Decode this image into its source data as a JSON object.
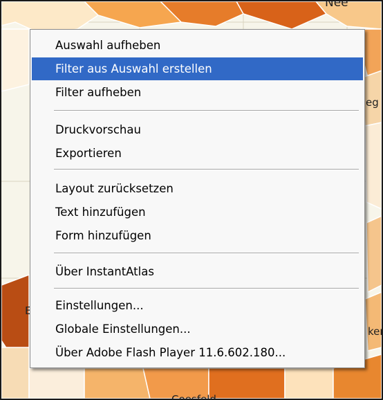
{
  "map": {
    "labels": {
      "top_right": "Nee",
      "right_eg": "eg",
      "left_e": "E",
      "right_ken": "ken",
      "bottom_c": "Coesfeld"
    },
    "colors": {
      "background": "#f7f5ea",
      "light": "#fde0b3",
      "medium": "#f6a64f",
      "strong": "#e57220",
      "dark": "#b94d14"
    }
  },
  "context_menu": {
    "groups": [
      {
        "items": [
          {
            "label": "Auswahl aufheben",
            "highlighted": false
          },
          {
            "label": "Filter aus Auswahl erstellen",
            "highlighted": true
          },
          {
            "label": "Filter aufheben",
            "highlighted": false
          }
        ]
      },
      {
        "items": [
          {
            "label": "Druckvorschau",
            "highlighted": false
          },
          {
            "label": "Exportieren",
            "highlighted": false
          }
        ]
      },
      {
        "items": [
          {
            "label": "Layout zurücksetzen",
            "highlighted": false
          },
          {
            "label": "Text hinzufügen",
            "highlighted": false
          },
          {
            "label": "Form hinzufügen",
            "highlighted": false
          }
        ]
      },
      {
        "items": [
          {
            "label": "Über InstantAtlas",
            "highlighted": false
          }
        ]
      },
      {
        "items": [
          {
            "label": "Einstellungen...",
            "highlighted": false
          },
          {
            "label": "Globale Einstellungen...",
            "highlighted": false
          },
          {
            "label": "Über Adobe Flash Player 11.6.602.180...",
            "highlighted": false
          }
        ]
      }
    ],
    "highlight_color": "#3169c6"
  }
}
